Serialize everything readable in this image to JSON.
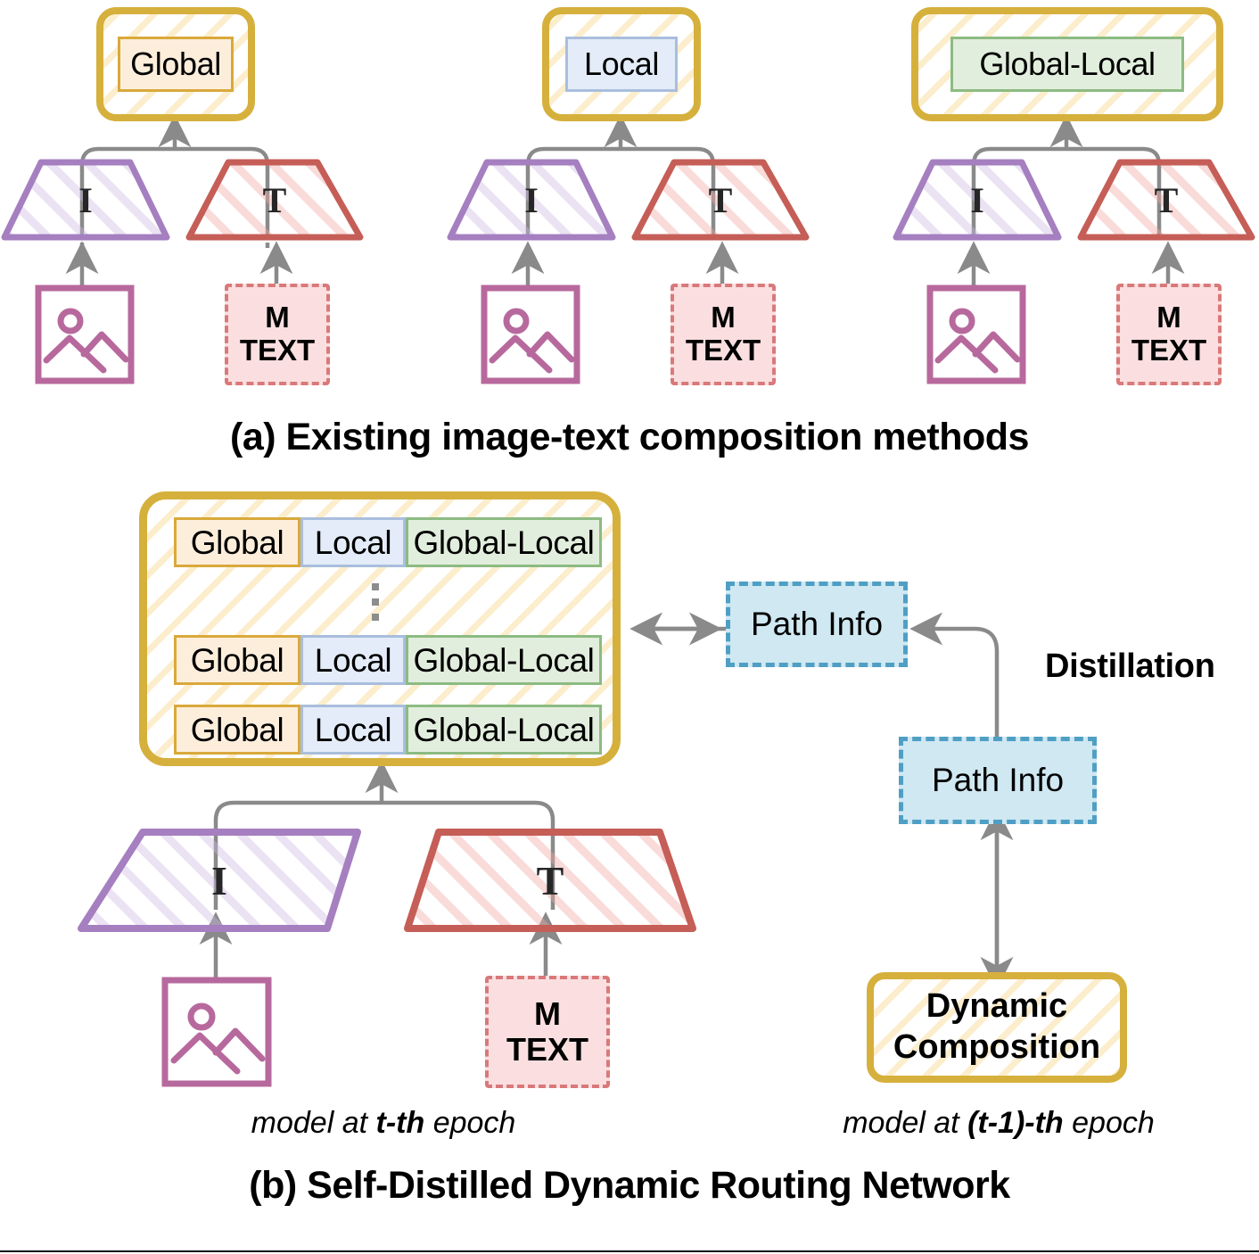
{
  "figure": {
    "panels": [
      {
        "id": "a",
        "caption": "(a) Existing image-text composition methods",
        "methods": [
          {
            "output_label": "Global",
            "image_encoder": "I",
            "text_encoder": "T",
            "text_input_line1": "M",
            "text_input_line2": "TEXT"
          },
          {
            "output_label": "Local",
            "image_encoder": "I",
            "text_encoder": "T",
            "text_input_line1": "M",
            "text_input_line2": "TEXT"
          },
          {
            "output_label": "Global-Local",
            "image_encoder": "I",
            "text_encoder": "T",
            "text_input_line1": "M",
            "text_input_line2": "TEXT"
          }
        ]
      },
      {
        "id": "b",
        "caption": "(b) Self-Distilled Dynamic Routing Network",
        "routing": {
          "rows": [
            {
              "cells": [
                "Global",
                "Local",
                "Global-Local"
              ]
            },
            {
              "cells": [
                "Global",
                "Local",
                "Global-Local"
              ]
            },
            {
              "cells": [
                "Global",
                "Local",
                "Global-Local"
              ]
            }
          ],
          "ellipsis": "vertical-dots"
        },
        "image_encoder": "I",
        "text_encoder": "T",
        "text_input_line1": "M",
        "text_input_line2": "TEXT",
        "student_caption_prefix": "model  at ",
        "student_caption_bold": "t-th",
        "student_caption_suffix": " epoch",
        "teacher_caption_prefix": "model at ",
        "teacher_caption_bold": "(t-1)-th",
        "teacher_caption_suffix": " epoch",
        "path_info_top": "Path Info",
        "path_info_bottom": "Path Info",
        "distillation_label": "Distillation",
        "dynamic_composition_line1": "Dynamic",
        "dynamic_composition_line2": "Composition"
      }
    ]
  },
  "colors": {
    "gold_border": "#d6b03c",
    "global_fill": "#fdeedc",
    "global_border": "#d9a93a",
    "local_fill": "#e3ecf8",
    "local_border": "#a9bedd",
    "global_local_fill": "#e2eedd",
    "global_local_border": "#8cbb82",
    "image_encoder": "#a57fc0",
    "text_encoder": "#c55e57",
    "image_icon": "#b7699d",
    "text_box_fill": "#fbdfe0",
    "text_box_border": "#d9797a",
    "path_info_fill": "#cfe8f2",
    "path_info_border": "#4f9fc4",
    "arrow_gray": "#8a8a8a"
  }
}
